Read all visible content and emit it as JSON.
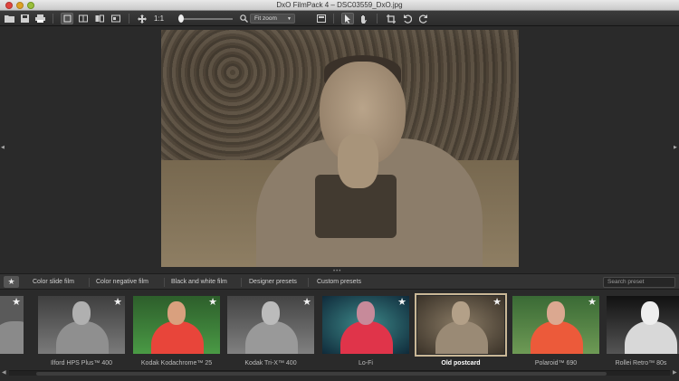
{
  "window": {
    "title": "DxO FilmPack 4 – DSC03559_DxO.jpg"
  },
  "toolbar": {
    "zoom_one_to_one": "1:1",
    "zoom_mode": "Fit zoom"
  },
  "tabs": {
    "items": [
      {
        "label": "Color slide film"
      },
      {
        "label": "Color negative film"
      },
      {
        "label": "Black and white film"
      },
      {
        "label": "Designer presets"
      },
      {
        "label": "Custom presets"
      }
    ],
    "search_placeholder": "Search preset"
  },
  "presets": [
    {
      "label": "Ilford HPS Plus™ 400",
      "style": "bw"
    },
    {
      "label": "Kodak Kodachrome™ 25",
      "style": "color"
    },
    {
      "label": "Kodak Tri-X™ 400",
      "style": "bw"
    },
    {
      "label": "Lo-Fi",
      "style": "lofi"
    },
    {
      "label": "Old postcard",
      "style": "sepia",
      "selected": true
    },
    {
      "label": "Polaroid™ 690",
      "style": "color"
    },
    {
      "label": "Rollei Retro™ 80s",
      "style": "bwhigh"
    }
  ],
  "colors": {
    "selection_outline": "#c9b796",
    "shirt_red": "#e8453a",
    "foliage_green": "#3e8a3a"
  }
}
